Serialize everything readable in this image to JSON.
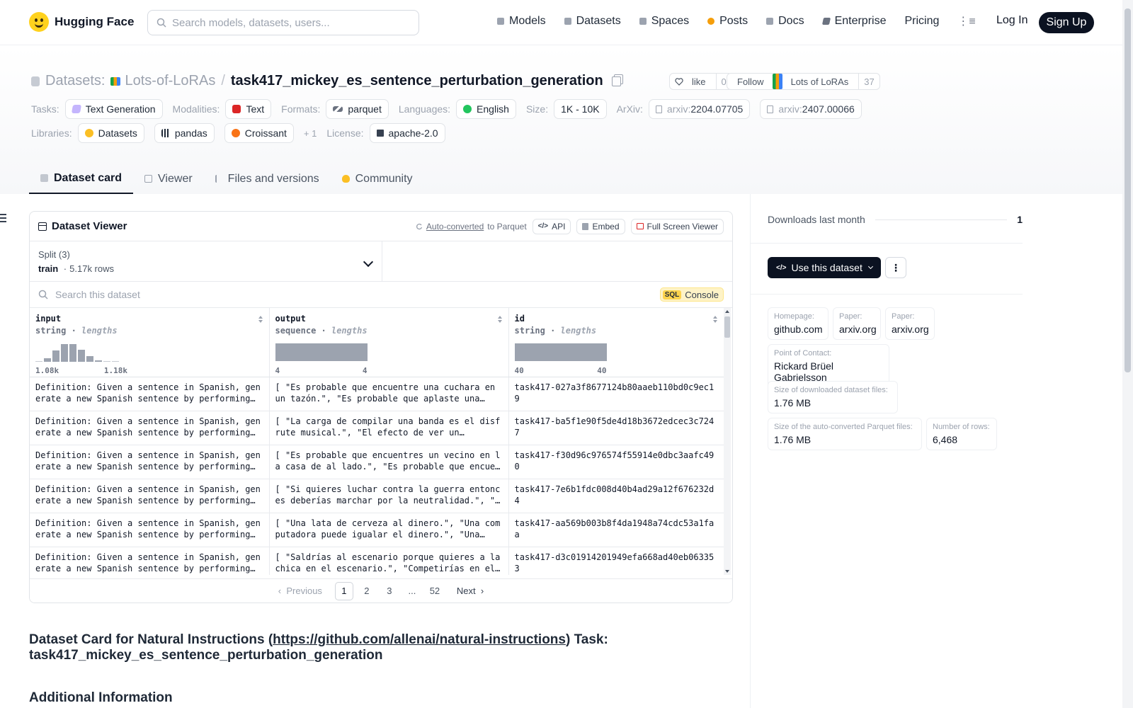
{
  "nav": {
    "brand": "Hugging Face",
    "search_placeholder": "Search models, datasets, users...",
    "items": [
      {
        "label": "Models",
        "icon": "cube-icon"
      },
      {
        "label": "Datasets",
        "icon": "database-icon"
      },
      {
        "label": "Spaces",
        "icon": "grid-icon"
      },
      {
        "label": "Posts",
        "icon": "posts-icon"
      },
      {
        "label": "Docs",
        "icon": "docs-icon"
      },
      {
        "label": "Enterprise",
        "icon": "enterprise-icon"
      },
      {
        "label": "Pricing"
      }
    ],
    "login": "Log In",
    "signup": "Sign Up"
  },
  "header": {
    "crumb_label": "Datasets:",
    "org": "Lots-of-LoRAs",
    "slash": "/",
    "repo": "task417_mickey_es_sentence_perturbation_generation",
    "like_label": "like",
    "like_count": "0",
    "follow_label": "Follow",
    "follow_org": "Lots of LoRAs",
    "follow_count": "37",
    "tags": {
      "tasks_label": "Tasks:",
      "tasks": "Text Generation",
      "modalities_label": "Modalities:",
      "modalities": "Text",
      "formats_label": "Formats:",
      "formats": "parquet",
      "languages_label": "Languages:",
      "languages": "English",
      "size_label": "Size:",
      "size": "1K - 10K",
      "arxiv_label": "ArXiv:",
      "arxiv_prefix": "arxiv:",
      "arxiv1": "2204.07705",
      "arxiv2": "2407.00066",
      "libraries_label": "Libraries:",
      "lib1": "Datasets",
      "lib2": "pandas",
      "lib3": "Croissant",
      "lib_more": "+ 1",
      "license_label": "License:",
      "license": "apache-2.0"
    },
    "tabs": [
      {
        "label": "Dataset card"
      },
      {
        "label": "Viewer"
      },
      {
        "label": "Files and versions"
      },
      {
        "label": "Community"
      }
    ]
  },
  "viewer": {
    "title": "Dataset Viewer",
    "auto_converted": "Auto-converted",
    "to_parquet": "to Parquet",
    "api": "API",
    "embed": "Embed",
    "full_screen": "Full Screen Viewer",
    "split_label": "Split (3)",
    "split_name": "train",
    "split_dot": "·",
    "split_rows": "5.17k rows",
    "search_placeholder": "Search this dataset",
    "sql_badge": "SQL",
    "sql_console": "Console",
    "columns": [
      {
        "name": "input",
        "type": "string",
        "stat": "lengths",
        "min": "1.08k",
        "max": "1.18k",
        "hist": [
          0.05,
          0.2,
          0.6,
          0.95,
          0.95,
          0.65,
          0.3,
          0.08,
          0.03,
          0.03
        ]
      },
      {
        "name": "output",
        "type": "sequence",
        "stat": "lengths",
        "min": "4",
        "max": "4"
      },
      {
        "name": "id",
        "type": "string",
        "stat": "lengths",
        "min": "40",
        "max": "40"
      }
    ],
    "rows": [
      {
        "input": "Definition: Given a sentence in Spanish, generate a new Spanish sentence by performing…",
        "output": "[ \"Es probable que encuentre una cuchara en un tazón.\", \"Es probable que aplaste una…",
        "id": "task417-027a3f8677124b80aaeb110bd0c9ec19"
      },
      {
        "input": "Definition: Given a sentence in Spanish, generate a new Spanish sentence by performing…",
        "output": "[ \"La carga de compilar una banda es el disfrute musical.\", \"El efecto de ver un…",
        "id": "task417-ba5f1e90f5de4d18b3672edcec3c7247"
      },
      {
        "input": "Definition: Given a sentence in Spanish, generate a new Spanish sentence by performing…",
        "output": "[ \"Es probable que encuentres un vecino en la casa de al lado.\", \"Es probable que encuentre…",
        "id": "task417-f30d96c976574f55914e0dbc3aafc490"
      },
      {
        "input": "Definition: Given a sentence in Spanish, generate a new Spanish sentence by performing…",
        "output": "[ \"Si quieres luchar contra la guerra entonces deberías marchar por la neutralidad.\", \"Si…",
        "id": "task417-7e6b1fdc008d40b4ad29a12f676232d4"
      },
      {
        "input": "Definition: Given a sentence in Spanish, generate a new Spanish sentence by performing…",
        "output": "[ \"Una lata de cerveza al dinero.\", \"Una computadora puede igualar el dinero.\", \"Una…",
        "id": "task417-aa569b003b8f4da1948a74cdc53a1faa"
      },
      {
        "input": "Definition: Given a sentence in Spanish, generate a new Spanish sentence by performing…",
        "output": "[ \"Saldrías al escenario porque quieres a la chica en el escenario.\", \"Competirías en el…",
        "id": "task417-d3c01914201949efa668ad40eb063353"
      }
    ],
    "pager": {
      "prev": "Previous",
      "pages": [
        "1",
        "2",
        "3",
        "...",
        "52"
      ],
      "next": "Next"
    }
  },
  "card": {
    "title_pre": "Dataset Card for Natural Instructions (",
    "title_link": "https://github.com/allenai/natural-instructions",
    "title_post": ") Task: task417_mickey_es_sentence_perturbation_generation",
    "additional": "Additional Information"
  },
  "sidebar": {
    "downloads_label": "Downloads last month",
    "downloads_value": "1",
    "use_dataset": "Use this dataset",
    "kebab": "⋮",
    "homepage_label": "Homepage:",
    "homepage": "github.com",
    "paper1_label": "Paper:",
    "paper1": "arxiv.org",
    "paper2_label": "Paper:",
    "paper2": "arxiv.org",
    "contact_label": "Point of Contact:",
    "contact": "Rickard Brüel Gabrielsson",
    "dl_size_label": "Size of downloaded dataset files:",
    "dl_size": "1.76 MB",
    "pq_size_label": "Size of the auto-converted Parquet files:",
    "pq_size": "1.76 MB",
    "rows_label": "Number of rows:",
    "rows": "6,468"
  }
}
